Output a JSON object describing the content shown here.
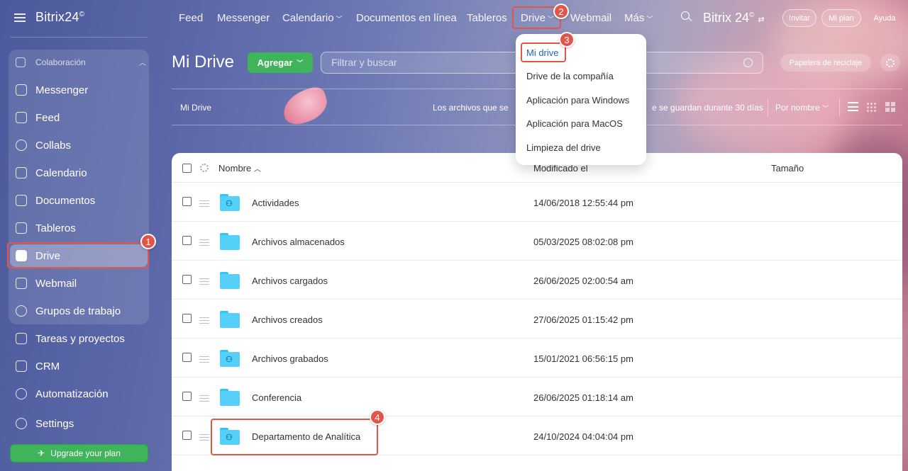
{
  "sidebar": {
    "brand": "Bitrix24",
    "brand_sup": "©",
    "section_label": "Colaboración",
    "items": [
      {
        "label": "Messenger"
      },
      {
        "label": "Feed"
      },
      {
        "label": "Collabs"
      },
      {
        "label": "Calendario"
      },
      {
        "label": "Documentos"
      },
      {
        "label": "Tableros"
      },
      {
        "label": "Drive",
        "active": true
      },
      {
        "label": "Webmail"
      },
      {
        "label": "Grupos de trabajo"
      },
      {
        "label": "Tareas y proyectos"
      },
      {
        "label": "CRM"
      },
      {
        "label": "Automatización"
      },
      {
        "label": "Settings"
      }
    ],
    "upgrade_label": "Upgrade your plan"
  },
  "topbar": {
    "items": [
      "Feed",
      "Messenger",
      "Calendario",
      "Documentos en línea",
      "Tableros",
      "Drive",
      "Webmail",
      "Más"
    ],
    "brand": "Bitrix 24",
    "brand_sup": "©",
    "invite_label": "Invitar",
    "plan_label": "Mi plan",
    "help_label": "Ayuda"
  },
  "header": {
    "title": "Mi Drive",
    "add_label": "Agregar",
    "filter_placeholder": "Filtrar y buscar",
    "trash_label": "Papelera de reciclaje"
  },
  "infobar": {
    "breadcrumb": "Mi Drive",
    "notice_start": "Los archivos que se",
    "notice_end": "e se guardan durante 30 días",
    "sort_label": "Por nombre"
  },
  "table": {
    "col_name": "Nombre",
    "col_modified": "Modificado el",
    "col_size": "Tamaño",
    "rows": [
      {
        "name": "Actividades",
        "modified": "14/06/2018 12:55:44 pm",
        "shared": true
      },
      {
        "name": "Archivos almacenados",
        "modified": "05/03/2025 08:02:08 pm",
        "shared": false
      },
      {
        "name": "Archivos cargados",
        "modified": "26/06/2025 02:00:54 am",
        "shared": false
      },
      {
        "name": "Archivos creados",
        "modified": "27/06/2025 01:15:42 pm",
        "shared": false
      },
      {
        "name": "Archivos grabados",
        "modified": "15/01/2021 06:56:15 pm",
        "shared": true
      },
      {
        "name": "Conferencia",
        "modified": "26/06/2025 01:18:14 am",
        "shared": false
      },
      {
        "name": "Departamento de Analítica",
        "modified": "24/10/2024 04:04:04 pm",
        "shared": true
      }
    ]
  },
  "drive_menu": {
    "items": [
      "Mi drive",
      "Drive de la compañía",
      "Aplicación para Windows",
      "Aplicación para MacOS",
      "Limpieza del drive"
    ]
  },
  "steps": [
    "1",
    "2",
    "3",
    "4"
  ],
  "colors": {
    "accent_green": "#3fb45a",
    "highlight_red": "#e2564a",
    "folder_blue": "#55d0f8",
    "link_blue": "#2067b0"
  }
}
